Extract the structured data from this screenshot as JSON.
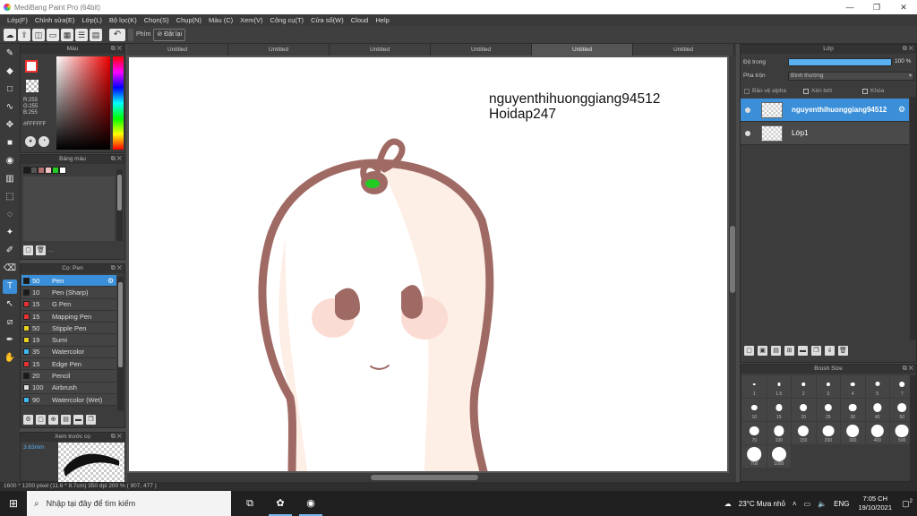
{
  "window": {
    "title": "MediBang Paint Pro (64bit)",
    "controls": [
      "—",
      "❐",
      "✕"
    ]
  },
  "menu": [
    "Lớp(F)",
    "Chỉnh sửa(E)",
    "Lớp(L)",
    "Bộ lọc(K)",
    "Chọn(S)",
    "Chụp(N)",
    "Màu (C)",
    "Xem(V)",
    "Công cụ(T)",
    "Cửa sổ(W)",
    "Cloud",
    "Help"
  ],
  "toolbar": {
    "undo_icon": "undo-arrow",
    "label_keys": "Phím",
    "reset_label": "Đặt lại"
  },
  "tabs": [
    "Untitled",
    "Untitled",
    "Untitled",
    "Untitled",
    "Untitled",
    "Untitled"
  ],
  "color_panel": {
    "title": "Màu",
    "rgb": [
      "R:255",
      "G:255",
      "B:255"
    ],
    "hex": "#FFFFFF",
    "fg_color": "#ffffff",
    "bg_color": "transparent"
  },
  "palette_panel": {
    "title": "Bảng màu",
    "swatches": [
      "#1a1a1a",
      "#555555",
      "#b07070",
      "#f0c0c0",
      "#22cc22",
      "#ffffff"
    ],
    "more": "..."
  },
  "brush_panel": {
    "title": "Cọ: Pen",
    "items": [
      {
        "color": "#1a1a1a",
        "size": "50",
        "name": "Pen",
        "selected": true
      },
      {
        "color": "#1a1a1a",
        "size": "10",
        "name": "Pen (Sharp)"
      },
      {
        "color": "#e33333",
        "size": "15",
        "name": "G Pen"
      },
      {
        "color": "#e33333",
        "size": "15",
        "name": "Mapping Pen"
      },
      {
        "color": "#e8d020",
        "size": "50",
        "name": "Stipple Pen"
      },
      {
        "color": "#e8d020",
        "size": "19",
        "name": "Sumi"
      },
      {
        "color": "#40b8f0",
        "size": "35",
        "name": "Watercolor"
      },
      {
        "color": "#e33333",
        "size": "15",
        "name": "Edge Pen"
      },
      {
        "color": "#1a1a1a",
        "size": "20",
        "name": "Pencil"
      },
      {
        "color": "#dddddd",
        "size": "100",
        "name": "Airbrush"
      },
      {
        "color": "#40b8f0",
        "size": "90",
        "name": "Watercolor (Wet)"
      }
    ]
  },
  "preview_panel": {
    "title": "Xem trước cọ",
    "size_label": "3.63mm"
  },
  "canvas": {
    "text_line1": "nguyenthihuonggiang94512",
    "text_line2": "Hoidap247"
  },
  "status": "1600 * 1200 pixel  (11.6 * 8.7cm)  350 dpi  200 %  ( 907, 477 )",
  "layer_panel": {
    "title": "Lớp",
    "opacity_label": "Độ trong",
    "opacity_value": "100 %",
    "opacity_fraction": 1.0,
    "blend_label": "Pha trộn",
    "blend_value": "Bình thường",
    "protect_alpha": "Bảo vệ alpha",
    "clipping": "Xén bớt",
    "lock": "Khóa",
    "layers": [
      {
        "name": "nguyenthihuonggiang94512",
        "selected": true
      },
      {
        "name": "Lớp1",
        "selected": false
      }
    ]
  },
  "brush_size_panel": {
    "title": "Brush Size",
    "sizes": [
      "1",
      "1.5",
      "2",
      "3",
      "4",
      "5",
      "7",
      "10",
      "15",
      "20",
      "25",
      "30",
      "40",
      "50",
      "70",
      "100",
      "150",
      "200",
      "300",
      "400",
      "500",
      "700",
      "1000"
    ]
  },
  "taskbar": {
    "search_placeholder": "Nhập tại đây để tìm kiếm",
    "weather": "23°C  Mưa nhỏ",
    "lang": "ENG",
    "time": "7:05 CH",
    "date": "19/10/2021",
    "notif_count": "2"
  },
  "colors": {
    "accent": "#3b8fd8",
    "outline": "#a06a64",
    "skin": "#fdeee6",
    "eye_green": "#22cc22"
  }
}
